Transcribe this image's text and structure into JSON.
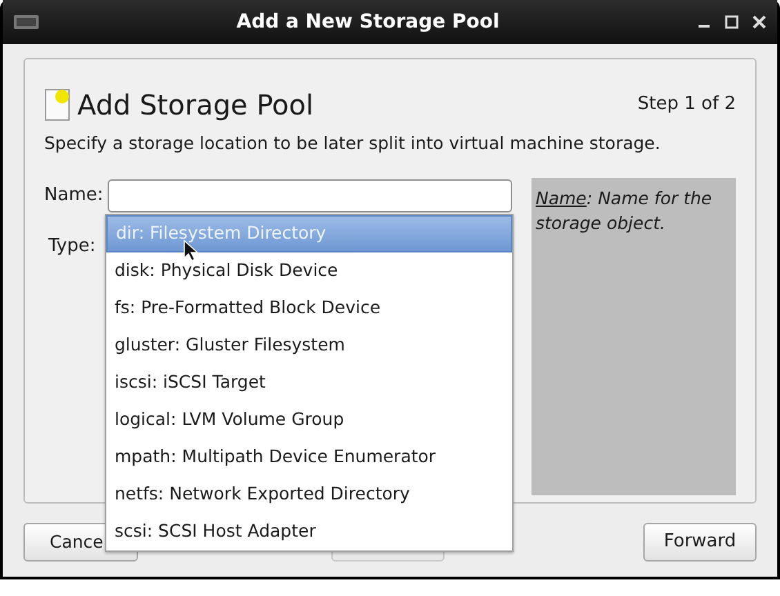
{
  "window": {
    "title": "Add a New Storage Pool"
  },
  "header": {
    "title": "Add Storage Pool",
    "step": "Step 1 of 2",
    "description": "Specify a storage location to be later split into virtual machine storage."
  },
  "form": {
    "name_label": "Name:",
    "type_label": "Type:"
  },
  "help": {
    "term": "Name",
    "text": ": Name for the storage object."
  },
  "type_options": [
    {
      "label": "dir: Filesystem Directory",
      "selected": true
    },
    {
      "label": "disk: Physical Disk Device",
      "selected": false
    },
    {
      "label": "fs: Pre-Formatted Block Device",
      "selected": false
    },
    {
      "label": "gluster: Gluster Filesystem",
      "selected": false
    },
    {
      "label": "iscsi: iSCSI Target",
      "selected": false
    },
    {
      "label": "logical: LVM Volume Group",
      "selected": false
    },
    {
      "label": "mpath: Multipath Device Enumerator",
      "selected": false
    },
    {
      "label": "netfs: Network Exported Directory",
      "selected": false
    },
    {
      "label": "scsi: SCSI Host Adapter",
      "selected": false
    }
  ],
  "buttons": {
    "cancel": {
      "label": "Cance"
    },
    "back": {
      "disabled": true
    },
    "forward": {
      "label": "Forward",
      "disabled": false
    }
  }
}
